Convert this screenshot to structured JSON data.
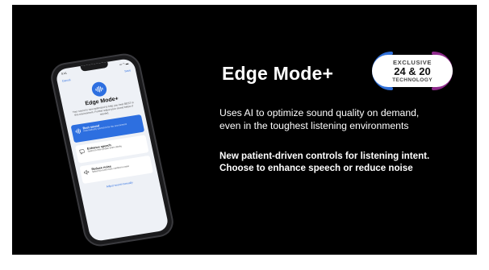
{
  "slide": {
    "headline": "Edge Mode+",
    "badge": {
      "top": "EXCLUSIVE",
      "middle": "24 & 20",
      "bottom": "TECHNOLOGY",
      "ring_colors": [
        "#2f6fd8",
        "#8e2a8c"
      ]
    },
    "description_lines": [
      "Uses AI to optimize sound quality on demand,",
      "even in the toughest listening environments"
    ],
    "feature_lines": [
      "New patient-driven controls for listening intent.",
      "Choose to enhance speech or reduce noise"
    ]
  },
  "phone": {
    "status_time": "9:41",
    "status_icons": "▪▪ ◠ ▬",
    "nav": {
      "cancel": "Cancel",
      "save": "Save"
    },
    "app_icon": "sound-wave-icon",
    "title": "Edge Mode+",
    "intro": "Your sound is now optimized to help you hear BEST in this environment. Further adjust your sound below if needed.",
    "options": [
      {
        "label": "Best sound",
        "sub": "Automatically optimized for the environment",
        "icon": "sound-wave-icon",
        "selected": true
      },
      {
        "label": "Enhance speech",
        "sub": "Select to hear people more clearly",
        "icon": "speech-icon",
        "selected": false
      },
      {
        "label": "Reduce noise",
        "sub": "Select for even more comfort in noise",
        "icon": "speaker-muted-icon",
        "selected": false
      }
    ],
    "manual_link": "Adjust sound manually"
  },
  "colors": {
    "accent": "#2d6fe0",
    "background": "#000000",
    "text": "#ffffff"
  }
}
